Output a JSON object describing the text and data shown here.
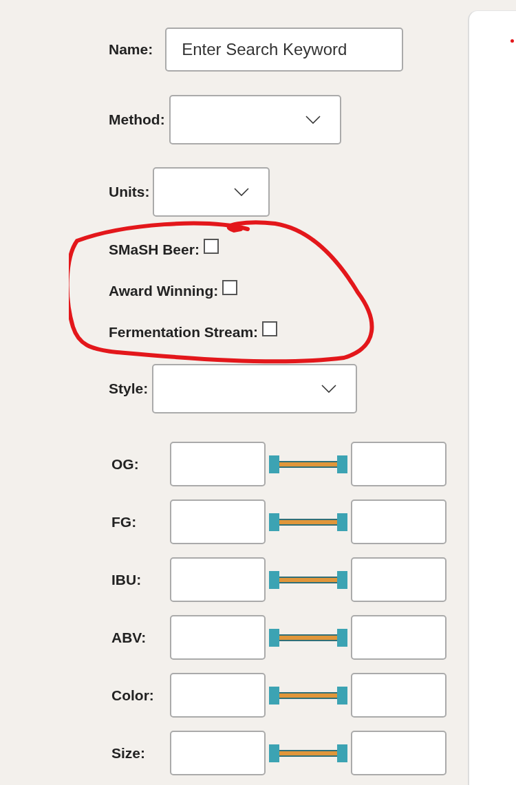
{
  "form": {
    "name": {
      "label": "Name:",
      "placeholder": "Enter Search Keyword"
    },
    "selects": [
      {
        "label": "Method:"
      },
      {
        "label": "Units:"
      }
    ],
    "checkboxes": [
      {
        "label": "SMaSH Beer:",
        "checked": false
      },
      {
        "label": "Award Winning:",
        "checked": false
      },
      {
        "label": "Fermentation Stream:",
        "checked": false
      }
    ],
    "style": {
      "label": "Style:"
    },
    "ranges": [
      {
        "label": "OG:",
        "level": 1
      },
      {
        "label": "FG:",
        "level": 1
      },
      {
        "label": "IBU:",
        "level": 1
      },
      {
        "label": "ABV:",
        "level": 1
      },
      {
        "label": "Color:",
        "level": 1
      },
      {
        "label": "Size:",
        "level": 1
      }
    ]
  },
  "annotation_circle": {
    "color": "#e3171b"
  },
  "annotation_dot": {
    "color": "#e3171b"
  }
}
